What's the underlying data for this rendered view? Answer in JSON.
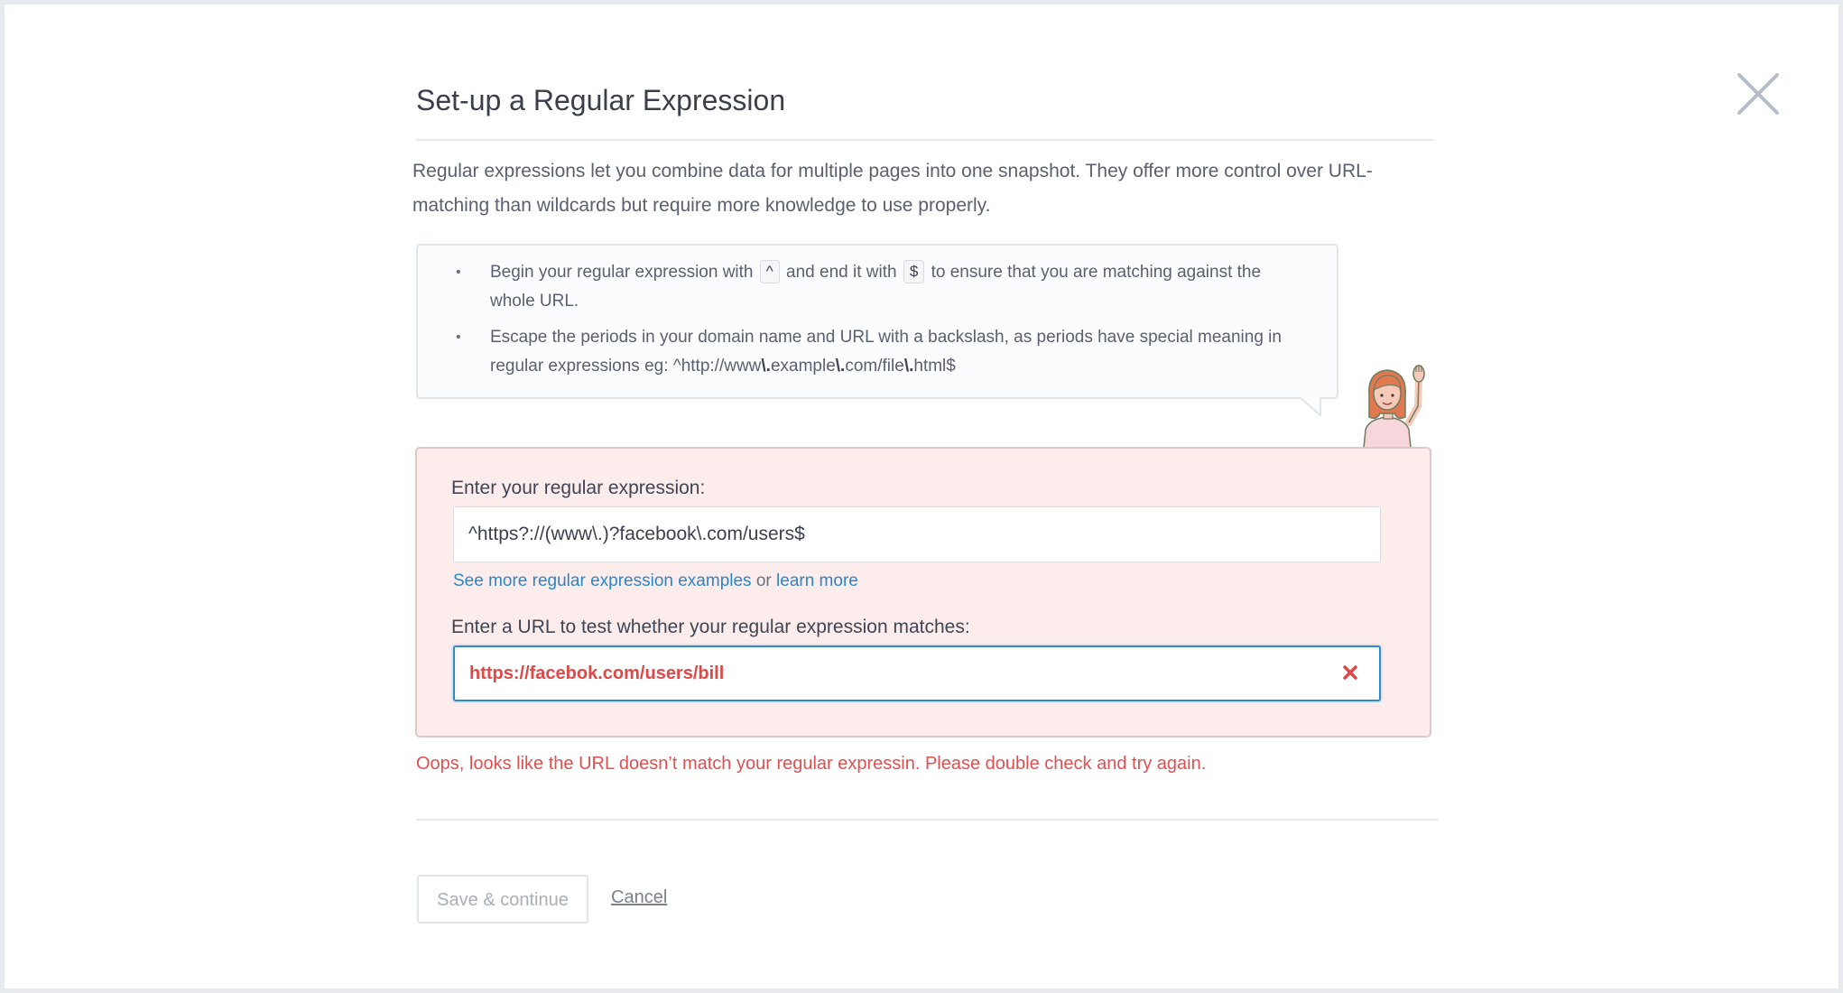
{
  "dialog": {
    "title": "Set-up a Regular Expression",
    "intro": "Regular expressions let you combine data for multiple pages into one snapshot. They offer more control over URL-matching than wildcards but require more knowledge to use properly.",
    "close_icon": "close-icon"
  },
  "tips": {
    "bullet": "•",
    "tip1": {
      "before": "Begin your regular expression with",
      "start_char": "^",
      "middle": "and end it with",
      "end_char": "$",
      "after": "to ensure that you are matching against the whole URL."
    },
    "tip2": {
      "text": "Escape the periods in your domain name and URL with a backslash, as periods have special meaning in regular expressions eg: ^http://www",
      "esc1": "\\.",
      "seg1": "example",
      "esc2": "\\.",
      "seg2": "com/file",
      "esc3": "\\.",
      "seg3": "html$"
    }
  },
  "regex_form": {
    "regex_label": "Enter your regular expression:",
    "regex_value": "^https?://(www\\.)?facebook\\.com/users$",
    "examples_link": "See more regular expression examples",
    "or_text": "or",
    "learn_more_link": "learn more",
    "url_label": "Enter a URL to test whether your regular expression matches:",
    "url_value": "https://facebok.com/users/bill",
    "clear_icon": "close-icon"
  },
  "error_message": "Oops, looks like the URL doesn’t match your regular expressin. Please double check and try again.",
  "actions": {
    "save_label": "Save & continue",
    "cancel_label": "Cancel"
  },
  "colors": {
    "accent_blue": "#2b86c8",
    "error_red": "#e05050",
    "panel_bg": "#fcecec"
  }
}
